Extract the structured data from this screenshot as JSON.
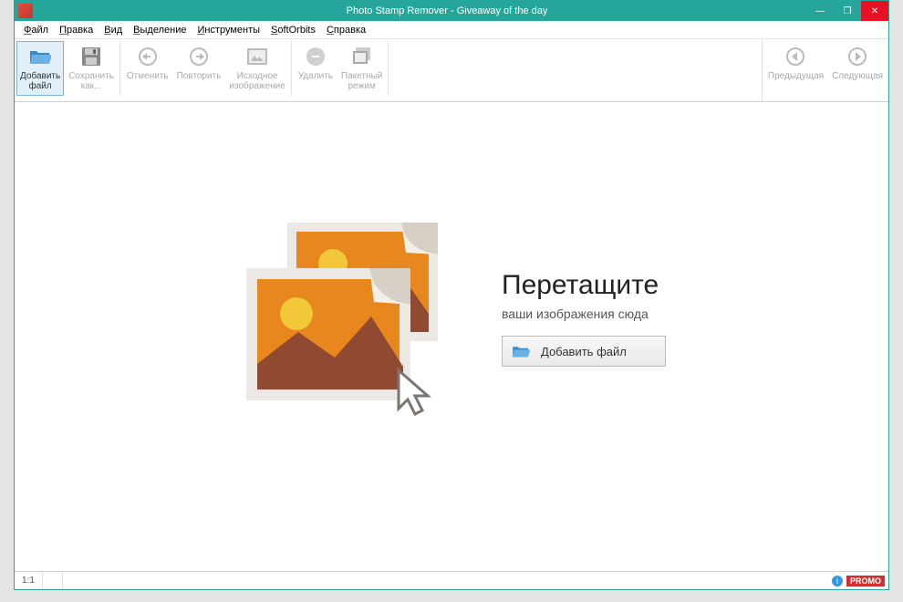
{
  "title": "Photo Stamp Remover - Giveaway of the day",
  "menu": [
    "Файл",
    "Правка",
    "Вид",
    "Выделение",
    "Инструменты",
    "SoftOrbits",
    "Справка"
  ],
  "toolbar": {
    "add_file": "Добавить\nфайл",
    "save_as": "Сохранить\nкак...",
    "undo": "Отменить",
    "redo": "Повторить",
    "original": "Исходное\nизображение",
    "delete": "Удалить",
    "batch": "Пакетный\nрежим",
    "prev": "Предыдущая",
    "next": "Следующая"
  },
  "drop": {
    "title": "Перетащите",
    "subtitle": "ваши изображения сюда",
    "button": "Добавить файл"
  },
  "status": {
    "zoom": "1:1",
    "promo": "PROMO"
  }
}
